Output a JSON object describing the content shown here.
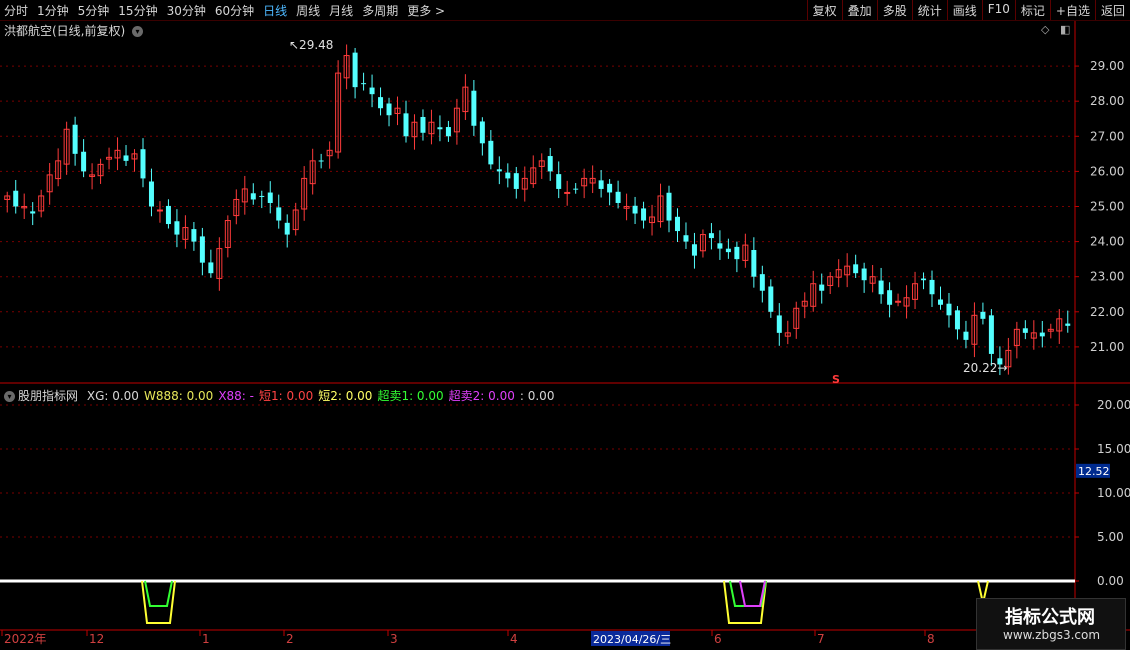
{
  "toolbar": {
    "left": [
      {
        "label": "分时"
      },
      {
        "label": "1分钟"
      },
      {
        "label": "5分钟"
      },
      {
        "label": "15分钟"
      },
      {
        "label": "30分钟"
      },
      {
        "label": "60分钟"
      },
      {
        "label": "日线"
      },
      {
        "label": "周线"
      },
      {
        "label": "月线"
      },
      {
        "label": "多周期"
      },
      {
        "label": "更多 >"
      }
    ],
    "active_index": 6,
    "right": [
      {
        "label": "复权"
      },
      {
        "label": "叠加"
      },
      {
        "label": "多股"
      },
      {
        "label": "统计"
      },
      {
        "label": "画线"
      },
      {
        "label": "F10"
      },
      {
        "label": "标记"
      },
      {
        "label": "+自选"
      },
      {
        "label": "返回"
      }
    ]
  },
  "price_panel": {
    "title": "洪都航空(日线,前复权)",
    "high_label": "29.48",
    "low_label": "20.22",
    "s_marker": "S",
    "y_ticks": [
      "29.00",
      "28.00",
      "27.00",
      "26.00",
      "25.00",
      "24.00",
      "23.00",
      "22.00",
      "21.00"
    ],
    "y_tick_values": [
      29,
      28,
      27,
      26,
      25,
      24,
      23,
      22,
      21
    ]
  },
  "indicator_panel": {
    "name": "股朋指标网",
    "fields": [
      {
        "text": "XG: 0.00",
        "color": "#d6d6d6"
      },
      {
        "text": "W888: 0.00",
        "color": "#e8e85a"
      },
      {
        "text": "X88: -",
        "color": "#e040fb"
      },
      {
        "text": "短1: 0.00",
        "color": "#ff4444"
      },
      {
        "text": "短2: 0.00",
        "color": "#ffff66"
      },
      {
        "text": "超卖1: 0.00",
        "color": "#33ff33"
      },
      {
        "text": "超卖2: 0.00",
        "color": "#e040fb"
      },
      {
        "text": ": 0.00",
        "color": "#d6d6d6"
      }
    ],
    "y_ticks": [
      "20.00",
      "15.00",
      "10.00",
      "5.00",
      "0.00"
    ],
    "y_tick_values": [
      20,
      15,
      10,
      5,
      0
    ],
    "current_value": "12.52"
  },
  "time_axis": {
    "labels": [
      "2022年",
      "12",
      "1",
      "2",
      "3",
      "4",
      "6",
      "7",
      "8"
    ],
    "highlight_label": "2023/04/26/三"
  },
  "colors": {
    "up": "#ff3b3b",
    "down": "#54ffff",
    "grid": "#7a0000",
    "axis": "#c00000"
  },
  "watermark": {
    "line1": "指标公式网",
    "line2": "www.zbgs3.com"
  },
  "chart_data": {
    "type": "candlestick",
    "y_range": [
      20.0,
      29.8
    ],
    "candles_close": [
      25.3,
      25.0,
      25.0,
      24.8,
      25.3,
      25.9,
      26.3,
      27.2,
      26.5,
      26.0,
      25.9,
      26.2,
      26.4,
      26.6,
      26.3,
      26.5,
      25.8,
      25.0,
      24.9,
      24.5,
      24.2,
      24.4,
      24.0,
      23.4,
      23.1,
      23.8,
      24.6,
      25.2,
      25.5,
      25.2,
      25.3,
      25.1,
      24.6,
      24.2,
      24.9,
      25.8,
      26.3,
      26.3,
      26.6,
      28.8,
      29.3,
      28.4,
      28.5,
      28.2,
      27.8,
      27.6,
      27.8,
      27.0,
      27.4,
      27.1,
      27.4,
      27.2,
      27.0,
      27.8,
      28.4,
      27.3,
      26.8,
      26.2,
      26.0,
      25.8,
      25.5,
      25.8,
      26.1,
      26.3,
      26.0,
      25.5,
      25.4,
      25.5,
      25.8,
      25.8,
      25.5,
      25.4,
      25.1,
      25.0,
      24.8,
      24.6,
      24.7,
      25.3,
      24.6,
      24.3,
      24.0,
      23.6,
      24.2,
      24.1,
      23.8,
      23.7,
      23.5,
      23.9,
      23.0,
      22.6,
      22.0,
      21.4,
      21.4,
      22.1,
      22.3,
      22.8,
      22.6,
      23.0,
      23.2,
      23.3,
      23.1,
      22.9,
      23.0,
      22.5,
      22.2,
      22.3,
      22.4,
      22.8,
      22.9,
      22.5,
      22.2,
      21.9,
      21.5,
      21.2,
      21.9,
      21.8,
      20.8,
      20.5,
      20.9,
      21.5,
      21.4,
      21.4,
      21.3,
      21.5,
      21.8,
      21.6
    ],
    "series": [
      {
        "name": "W888",
        "values": [
          0,
          0,
          0,
          -3,
          -3,
          0,
          0,
          0,
          0,
          0,
          0,
          0,
          0,
          0,
          0,
          0,
          0,
          0,
          0,
          0,
          0,
          0,
          0,
          -5,
          -5,
          0,
          0,
          0,
          0,
          0,
          0,
          0,
          0,
          0,
          0,
          0,
          0,
          0,
          0,
          0,
          0,
          0,
          0,
          0,
          0,
          0,
          0,
          0,
          0,
          0,
          0,
          0,
          0,
          0,
          0,
          0,
          0,
          0,
          0,
          0,
          0,
          0,
          0,
          0,
          0
        ]
      },
      {
        "name": "超卖1",
        "events": [
          {
            "x": 4,
            "y": -3
          },
          {
            "x": 23,
            "y": -5
          }
        ]
      },
      {
        "name": "超卖2",
        "events": [
          {
            "x": 23,
            "y": -3
          }
        ]
      },
      {
        "name": "短2",
        "events": [
          {
            "x": 4,
            "y": -5
          },
          {
            "x": 23,
            "y": -5
          },
          {
            "x": 29,
            "y": -2
          }
        ]
      }
    ]
  }
}
